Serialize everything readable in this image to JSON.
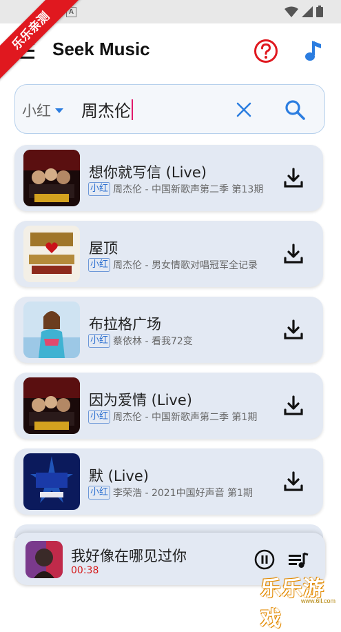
{
  "status_bar": {
    "notification_icon": "A"
  },
  "ribbon": {
    "text": "乐乐亲测"
  },
  "header": {
    "title": "Seek Music",
    "help_icon": "help-circle-icon",
    "music_icon": "music-note-icon",
    "menu_icon": "hamburger-menu-icon"
  },
  "search": {
    "source": "小红",
    "query": "周杰伦"
  },
  "songs": [
    {
      "title": "想你就写信 (Live)",
      "source": "小红",
      "meta": "周杰伦 - 中国新歌声第二季 第13期"
    },
    {
      "title": "屋顶",
      "source": "小红",
      "meta": "周杰伦 - 男女情歌对唱冠军全记录"
    },
    {
      "title": "布拉格广场",
      "source": "小红",
      "meta": "蔡依林 - 看我72变"
    },
    {
      "title": "因为爱情 (Live)",
      "source": "小红",
      "meta": "周杰伦 - 中国新歌声第二季 第1期"
    },
    {
      "title": "默 (Live)",
      "source": "小红",
      "meta": "李荣浩 - 2021中国好声音 第1期"
    }
  ],
  "player": {
    "title": "我好像在哪见过你",
    "time": "00:38"
  },
  "watermark": {
    "text": "乐乐游戏",
    "url": "www.6ll.com"
  },
  "colors": {
    "accent_blue": "#2b7de0",
    "help_red": "#e0181f",
    "card_bg": "#e3e9f3",
    "time_red": "#d61a1a"
  }
}
